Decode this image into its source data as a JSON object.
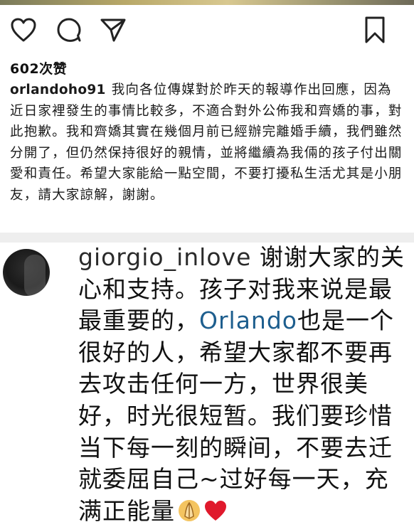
{
  "post": {
    "likes_text": "602次赞",
    "caption": {
      "username": "orlandoho91",
      "text": "我向各位傳媒對於昨天的報導作出回應，因為近日家裡發生的事情比較多，不適合對外公佈我和齊嬌的事，對此抱歉。我和齊嬌其實在幾個月前已經辦完離婚手續，我們雖然分開了，但仍然保持很好的親情，並將繼續為我倆的孩子付出關愛和責任。希望大家能給一點空間，不要打擾私生活尤其是小朋友，請大家諒解，謝謝。"
    }
  },
  "comment": {
    "username": "giorgio_inlove",
    "text_before_mention": "谢谢大家的关心和支持。孩子对我来说是最最重要的，",
    "mention": "Orlando",
    "text_after_mention": "也是一个很好的人，希望大家都不要再去攻击任何一方，世界很美好，时光很短暂。我们要珍惜当下每一刻的瞬间，不要去迁就委屈自己~过好每一天，充满正能量"
  },
  "icons": {
    "like": "heart-outline-icon",
    "comment": "comment-bubble-icon",
    "share": "paper-plane-icon",
    "save": "bookmark-icon",
    "emoji_1": "praying-hands-emoji",
    "emoji_2": "red-heart-emoji"
  },
  "colors": {
    "mention": "#1d5e8e",
    "heart_emoji": "#e0192c",
    "divider": "#eeeeee"
  }
}
